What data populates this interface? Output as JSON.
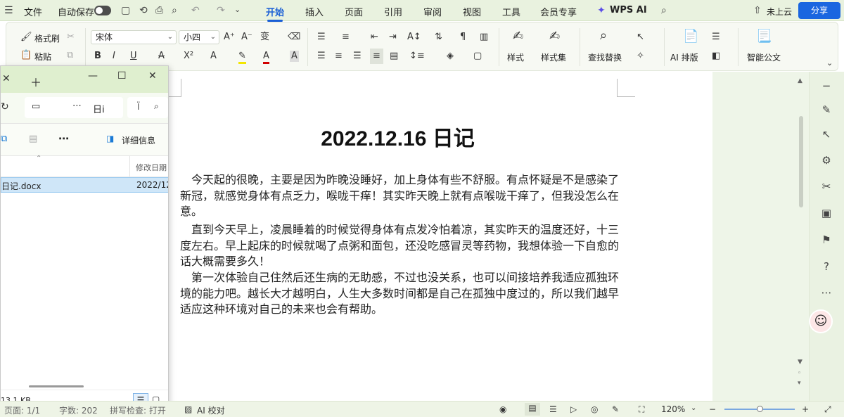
{
  "menubar": {
    "file": "文件",
    "autosave": "自动保存",
    "tabs": [
      "开始",
      "插入",
      "页面",
      "引用",
      "审阅",
      "视图",
      "工具",
      "会员专享"
    ],
    "wps_ai": "WPS AI",
    "cloud": "未上云",
    "share": "分享"
  },
  "ribbon": {
    "format_painter": "格式刷",
    "paste": "粘贴",
    "font_name": "宋体",
    "font_size": "小四",
    "styles": "样式",
    "style_set": "样式集",
    "find_replace": "查找替换",
    "ai_layout": "AI 排版",
    "smart_doc": "智能公文"
  },
  "document": {
    "title": "2022.12.16 日记",
    "paragraphs": [
      "今天起的很晚，主要是因为昨晚没睡好，加上身体有些不舒服。有点怀疑是不是感染了新冠，就感觉身体有点乏力，喉咙干痒！其实昨天晚上就有点喉咙干痒了，但我没怎么在意。",
      "直到今天早上，凌晨睡着的时候觉得身体有点发冷怕着凉，其实昨天的温度还好，十三度左右。早上起床的时候就喝了点粥和面包，还没吃感冒灵等药物，我想体验一下自愈的话大概需要多久！",
      "第一次体验自己住然后还生病的无助感，不过也没关系，也可以间接培养我适应孤独环境的能力吧。越长大才越明白，人生大多数时间都是自己在孤独中度过的，所以我们越早适应这种环境对自己的未来也会有帮助。"
    ]
  },
  "explorer": {
    "address": "日i",
    "search": "Ї",
    "details": "详细信息",
    "col_modified": "修改日期",
    "file_name": "日记.docx",
    "file_date": "2022/12",
    "size": "13.1 KB"
  },
  "statusbar": {
    "page": "页面: 1/1",
    "words": "字数: 202",
    "layout": "拼写检查: 打开",
    "ai_check": "AI 校对",
    "zoom": "120%"
  },
  "colors": {
    "accent": "#1a5fd6",
    "ribbon_bg": "#f7f9f3",
    "menubar_bg": "#e9f2df"
  }
}
